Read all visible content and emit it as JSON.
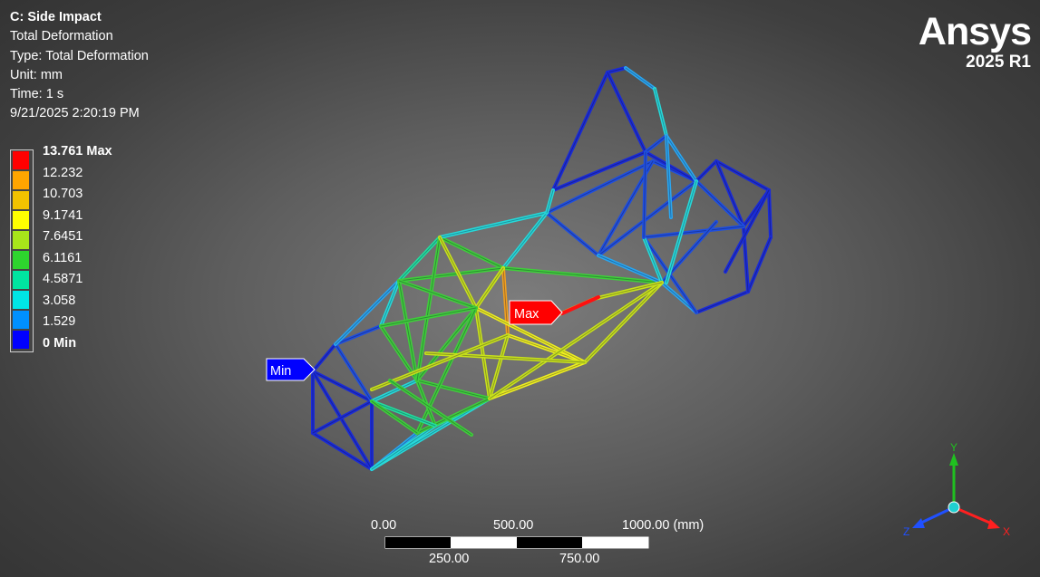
{
  "info": {
    "title": "C: Side Impact",
    "result": "Total Deformation",
    "type": "Type: Total Deformation",
    "unit": "Unit: mm",
    "time": "Time: 1 s",
    "timestamp": "9/21/2025 2:20:19 PM"
  },
  "legend": {
    "entries": [
      {
        "label": "13.761 Max",
        "color": "#ff0000",
        "bold": true
      },
      {
        "label": "12.232",
        "color": "#ffa500"
      },
      {
        "label": "10.703",
        "color": "#f2c200"
      },
      {
        "label": "9.1741",
        "color": "#ffff00"
      },
      {
        "label": "7.6451",
        "color": "#a8e51a"
      },
      {
        "label": "6.1161",
        "color": "#2ed42e"
      },
      {
        "label": "4.5871",
        "color": "#00e5a0"
      },
      {
        "label": "3.058",
        "color": "#00e5e5"
      },
      {
        "label": "1.529",
        "color": "#0090ff"
      },
      {
        "label": "0 Min",
        "color": "#0000ff",
        "bold": true
      }
    ]
  },
  "logo": {
    "brand": "Ansys",
    "version": "2025 R1"
  },
  "probes": {
    "max_label": "Max",
    "max_color": "#ff0000",
    "min_label": "Min",
    "min_color": "#0000ff"
  },
  "scale": {
    "top": [
      "0.00",
      "500.00",
      "1000.00 (mm)"
    ],
    "bottom": [
      "250.00",
      "750.00"
    ]
  },
  "triad": {
    "x_label": "X",
    "y_label": "Y",
    "z_label": "Z",
    "x_color": "#ff2020",
    "y_color": "#20c020",
    "z_color": "#2050ff"
  }
}
